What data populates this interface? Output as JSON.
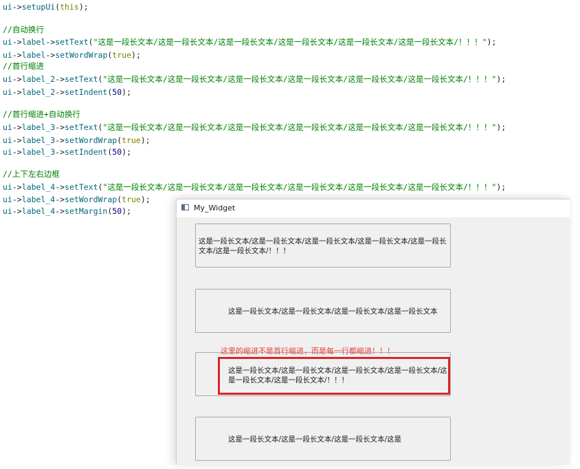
{
  "code": {
    "setup_line": "ui->setupUi(this);",
    "comment_autowrap": "//自动换行",
    "l1_text": "ui->label->setText(\"这是一段长文本/这是一段长文本/这是一段长文本/这是一段长文本/这是一段长文本/这是一段长文本/！！！\");",
    "l1_wrap": "ui->label->setWordWrap(true);",
    "comment_indent": "//首行缩进",
    "l2_text": "ui->label_2->setText(\"这是一段长文本/这是一段长文本/这是一段长文本/这是一段长文本/这是一段长文本/这是一段长文本/！！！\");",
    "l2_indent": "ui->label_2->setIndent(50);",
    "comment_indent_wrap": "//首行缩进+自动换行",
    "l3_text": "ui->label_3->setText(\"这是一段长文本/这是一段长文本/这是一段长文本/这是一段长文本/这是一段长文本/这是一段长文本/！！！\");",
    "l3_wrap": "ui->label_3->setWordWrap(true);",
    "l3_indent": "ui->label_3->setIndent(50);",
    "comment_margin": "//上下左右边框",
    "l4_text": "ui->label_4->setText(\"这是一段长文本/这是一段长文本/这是一段长文本/这是一段长文本/这是一段长文本/这是一段长文本/！！！\");",
    "l4_wrap": "ui->label_4->setWordWrap(true);",
    "l4_margin": "ui->label_4->setMargin(50);"
  },
  "window": {
    "title": "My_Widget",
    "label1_text": "这是一段长文本/这是一段长文本/这是一段长文本/这是一段长文本/这是一段长文本/这是一段长文本/！！！",
    "label2_text": "这是一段长文本/这是一段长文本/这是一段长文本/这是一段长文本",
    "label3_text": "这是一段长文本/这是一段长文本/这是一段长文本/这是一段长文本/这是一段长文本/这是一段长文本/！！！",
    "label4_text": "这是一段长文本/这是一段长文本/这是一段长文本/这是",
    "annotation": "这里的缩进不是首行缩进，而是每一行都缩进！！！"
  },
  "colors": {
    "annotation": "#e8423c",
    "highlight_border": "#d9262c",
    "code_string": "#008000",
    "code_identifier": "#00677c"
  }
}
